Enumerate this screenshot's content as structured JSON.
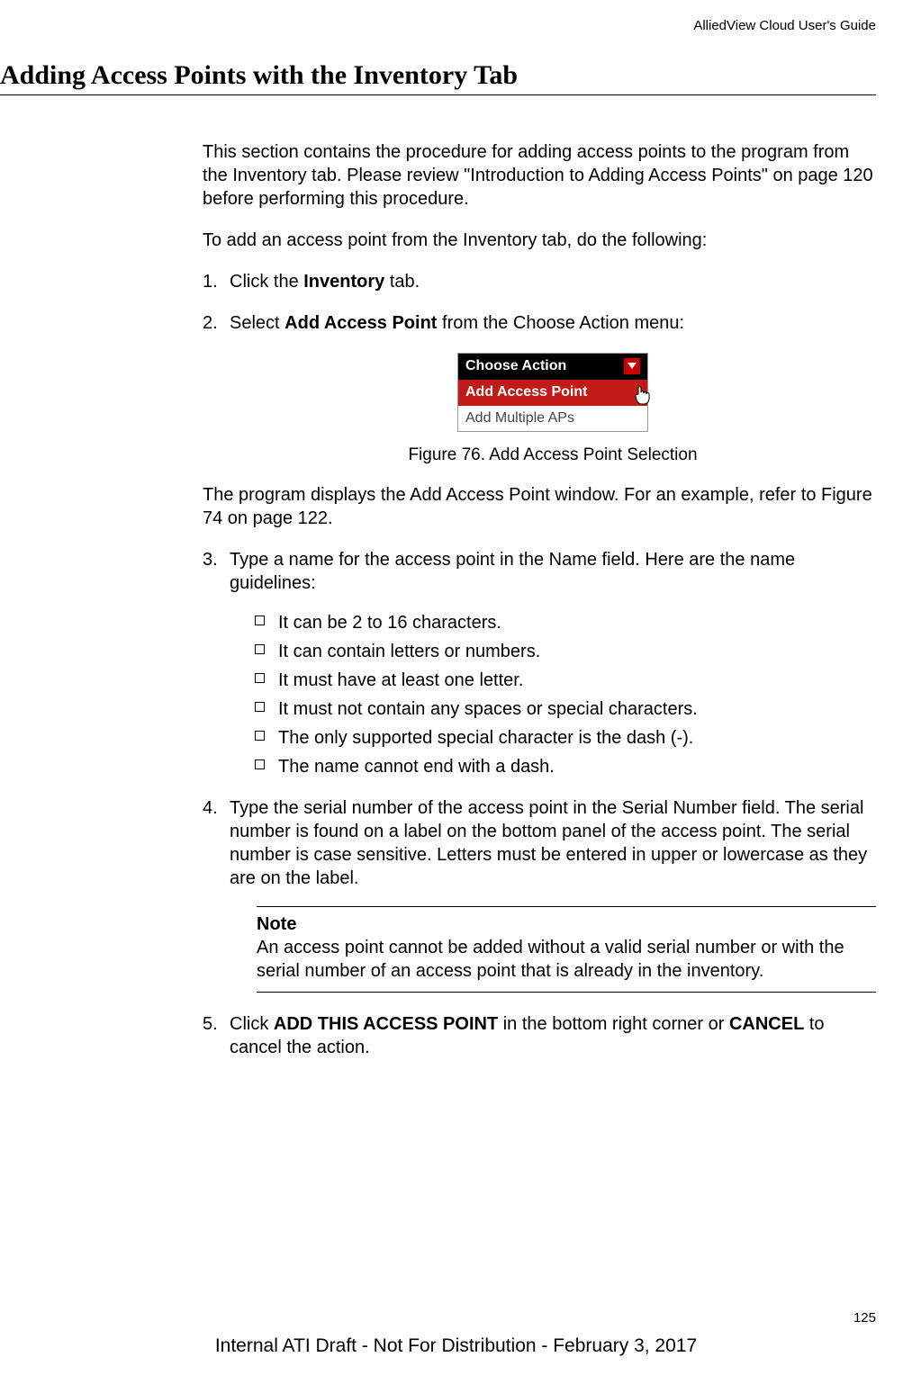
{
  "header": {
    "doc_title": "AlliedView Cloud User's Guide"
  },
  "section": {
    "title": "Adding Access Points with the Inventory Tab"
  },
  "intro": {
    "p1": "This section contains the procedure for adding access points to the program from the Inventory tab. Please review \"Introduction to Adding Access Points\" on page 120 before performing this procedure.",
    "p2": "To add an access point from the Inventory tab, do the following:"
  },
  "steps": {
    "s1_a": "Click the ",
    "s1_b": "Inventory",
    "s1_c": " tab.",
    "s2_a": "Select ",
    "s2_b": "Add Access Point",
    "s2_c": " from the Choose Action menu:",
    "s3": "Type a name for the access point in the Name field. Here are the name guidelines:",
    "s4": "Type the serial number of the access point in the Serial Number field. The serial number is found on a label on the bottom panel of the access point. The serial number is case sensitive. Letters must be entered in upper or lowercase as they are on the label.",
    "s5_a": "Click ",
    "s5_b": "ADD THIS ACCESS POINT",
    "s5_c": " in the bottom right corner or ",
    "s5_d": "CANCEL",
    "s5_e": " to cancel the action."
  },
  "dropdown": {
    "header": "Choose Action",
    "selected": "Add Access Point",
    "other": "Add Multiple APs"
  },
  "figure": {
    "caption": "Figure 76. Add Access Point Selection"
  },
  "after_figure": "The program displays the Add Access Point window. For an example, refer to Figure 74 on page 122.",
  "guidelines": [
    "It can be 2 to 16 characters.",
    "It can contain letters or numbers.",
    "It must have at least one letter.",
    "It must not contain any spaces or special characters.",
    "The only supported special character is the dash (-).",
    "The name cannot end with a dash."
  ],
  "note": {
    "title": "Note",
    "body": "An access point cannot be added without a valid serial number or with the serial number of an access point that is already in the inventory."
  },
  "page_number": "125",
  "footer": "Internal ATI Draft - Not For Distribution - February 3, 2017"
}
